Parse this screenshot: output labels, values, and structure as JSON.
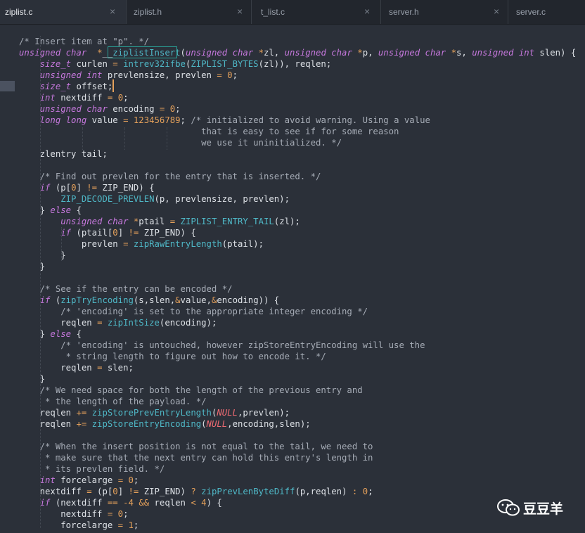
{
  "tabs": [
    {
      "label": "ziplist.c",
      "active": true
    },
    {
      "label": "ziplist.h",
      "active": false
    },
    {
      "label": "t_list.c",
      "active": false
    },
    {
      "label": "server.h",
      "active": false
    },
    {
      "label": "server.c",
      "active": false
    }
  ],
  "close_glyph": "×",
  "watermark": {
    "text": "豆豆羊",
    "icon": "wechat-icon"
  },
  "code": [
    [
      [
        "cm",
        "/* Insert item at \"p\". */"
      ]
    ],
    [
      [
        "ty",
        "unsigned char"
      ],
      [
        "",
        "  "
      ],
      [
        "op",
        "*"
      ],
      [
        "",
        "__"
      ],
      [
        "fn",
        "ziplistInsert"
      ],
      [
        "",
        "("
      ],
      [
        "ty",
        "unsigned char"
      ],
      [
        "",
        " "
      ],
      [
        "op",
        "*"
      ],
      [
        "",
        "zl, "
      ],
      [
        "ty",
        "unsigned char"
      ],
      [
        "",
        " "
      ],
      [
        "op",
        "*"
      ],
      [
        "",
        "p, "
      ],
      [
        "ty",
        "unsigned char"
      ],
      [
        "",
        " "
      ],
      [
        "op",
        "*"
      ],
      [
        "",
        "s, "
      ],
      [
        "ty",
        "unsigned int"
      ],
      [
        "",
        " slen) {"
      ]
    ],
    [
      [
        "",
        "    "
      ],
      [
        "ty",
        "size_t"
      ],
      [
        "",
        " curlen "
      ],
      [
        "op",
        "="
      ],
      [
        "",
        " "
      ],
      [
        "fn",
        "intrev32ifbe"
      ],
      [
        "",
        "("
      ],
      [
        "fn",
        "ZIPLIST_BYTES"
      ],
      [
        "",
        "(zl)), reqlen;"
      ]
    ],
    [
      [
        "",
        "    "
      ],
      [
        "ty",
        "unsigned int"
      ],
      [
        "",
        " prevlensize, prevlen "
      ],
      [
        "op",
        "="
      ],
      [
        "",
        " "
      ],
      [
        "num",
        "0"
      ],
      [
        "",
        ";"
      ]
    ],
    [
      [
        "",
        "    "
      ],
      [
        "ty",
        "size_t"
      ],
      [
        "",
        " offset;"
      ]
    ],
    [
      [
        "",
        "    "
      ],
      [
        "ty",
        "int"
      ],
      [
        "",
        " nextdiff "
      ],
      [
        "op",
        "="
      ],
      [
        "",
        " "
      ],
      [
        "num",
        "0"
      ],
      [
        "",
        ";"
      ]
    ],
    [
      [
        "",
        "    "
      ],
      [
        "ty",
        "unsigned char"
      ],
      [
        "",
        " encoding "
      ],
      [
        "op",
        "="
      ],
      [
        "",
        " "
      ],
      [
        "num",
        "0"
      ],
      [
        "",
        ";"
      ]
    ],
    [
      [
        "",
        "    "
      ],
      [
        "ty",
        "long long"
      ],
      [
        "",
        " value "
      ],
      [
        "op",
        "="
      ],
      [
        "",
        " "
      ],
      [
        "num",
        "123456789"
      ],
      [
        "",
        "; "
      ],
      [
        "cm",
        "/* initialized to avoid warning. Using a value"
      ]
    ],
    [
      [
        "cm",
        "                                   that is easy to see if for some reason"
      ]
    ],
    [
      [
        "cm",
        "                                   we use it uninitialized. */"
      ]
    ],
    [
      [
        "",
        "    zlentry tail;"
      ]
    ],
    [
      [
        "",
        ""
      ]
    ],
    [
      [
        "",
        "    "
      ],
      [
        "cm",
        "/* Find out prevlen for the entry that is inserted. */"
      ]
    ],
    [
      [
        "",
        "    "
      ],
      [
        "ty",
        "if"
      ],
      [
        "",
        " (p["
      ],
      [
        "num",
        "0"
      ],
      [
        "",
        "] "
      ],
      [
        "op",
        "!="
      ],
      [
        "",
        " ZIP_END) {"
      ]
    ],
    [
      [
        "",
        "        "
      ],
      [
        "fn",
        "ZIP_DECODE_PREVLEN"
      ],
      [
        "",
        "(p, prevlensize, prevlen);"
      ]
    ],
    [
      [
        "",
        "    } "
      ],
      [
        "ty",
        "else"
      ],
      [
        "",
        " {"
      ]
    ],
    [
      [
        "",
        "        "
      ],
      [
        "ty",
        "unsigned char"
      ],
      [
        "",
        " "
      ],
      [
        "op",
        "*"
      ],
      [
        "",
        "ptail "
      ],
      [
        "op",
        "="
      ],
      [
        "",
        " "
      ],
      [
        "fn",
        "ZIPLIST_ENTRY_TAIL"
      ],
      [
        "",
        "(zl);"
      ]
    ],
    [
      [
        "",
        "        "
      ],
      [
        "ty",
        "if"
      ],
      [
        "",
        " (ptail["
      ],
      [
        "num",
        "0"
      ],
      [
        "",
        "] "
      ],
      [
        "op",
        "!="
      ],
      [
        "",
        " ZIP_END) {"
      ]
    ],
    [
      [
        "",
        "            prevlen "
      ],
      [
        "op",
        "="
      ],
      [
        "",
        " "
      ],
      [
        "fn",
        "zipRawEntryLength"
      ],
      [
        "",
        "(ptail);"
      ]
    ],
    [
      [
        "",
        "        }"
      ]
    ],
    [
      [
        "",
        "    }"
      ]
    ],
    [
      [
        "",
        ""
      ]
    ],
    [
      [
        "",
        "    "
      ],
      [
        "cm",
        "/* See if the entry can be encoded */"
      ]
    ],
    [
      [
        "",
        "    "
      ],
      [
        "ty",
        "if"
      ],
      [
        "",
        " ("
      ],
      [
        "fn",
        "zipTryEncoding"
      ],
      [
        "",
        "(s,slen,"
      ],
      [
        "op",
        "&"
      ],
      [
        "",
        "value,"
      ],
      [
        "op",
        "&"
      ],
      [
        "",
        "encoding)) {"
      ]
    ],
    [
      [
        "",
        "        "
      ],
      [
        "cm",
        "/* 'encoding' is set to the appropriate integer encoding */"
      ]
    ],
    [
      [
        "",
        "        reqlen "
      ],
      [
        "op",
        "="
      ],
      [
        "",
        " "
      ],
      [
        "fn",
        "zipIntSize"
      ],
      [
        "",
        "(encoding);"
      ]
    ],
    [
      [
        "",
        "    } "
      ],
      [
        "ty",
        "else"
      ],
      [
        "",
        " {"
      ]
    ],
    [
      [
        "",
        "        "
      ],
      [
        "cm",
        "/* 'encoding' is untouched, however zipStoreEntryEncoding will use the"
      ]
    ],
    [
      [
        "cm",
        "         * string length to figure out how to encode it. */"
      ]
    ],
    [
      [
        "",
        "        reqlen "
      ],
      [
        "op",
        "="
      ],
      [
        "",
        " slen;"
      ]
    ],
    [
      [
        "",
        "    }"
      ]
    ],
    [
      [
        "",
        "    "
      ],
      [
        "cm",
        "/* We need space for both the length of the previous entry and"
      ]
    ],
    [
      [
        "cm",
        "     * the length of the payload. */"
      ]
    ],
    [
      [
        "",
        "    reqlen "
      ],
      [
        "op",
        "+="
      ],
      [
        "",
        " "
      ],
      [
        "fn",
        "zipStorePrevEntryLength"
      ],
      [
        "",
        "("
      ],
      [
        "nul",
        "NULL"
      ],
      [
        "",
        ",prevlen);"
      ]
    ],
    [
      [
        "",
        "    reqlen "
      ],
      [
        "op",
        "+="
      ],
      [
        "",
        " "
      ],
      [
        "fn",
        "zipStoreEntryEncoding"
      ],
      [
        "",
        "("
      ],
      [
        "nul",
        "NULL"
      ],
      [
        "",
        ",encoding,slen);"
      ]
    ],
    [
      [
        "",
        ""
      ]
    ],
    [
      [
        "",
        "    "
      ],
      [
        "cm",
        "/* When the insert position is not equal to the tail, we need to"
      ]
    ],
    [
      [
        "cm",
        "     * make sure that the next entry can hold this entry's length in"
      ]
    ],
    [
      [
        "cm",
        "     * its prevlen field. */"
      ]
    ],
    [
      [
        "",
        "    "
      ],
      [
        "ty",
        "int"
      ],
      [
        "",
        " forcelarge "
      ],
      [
        "op",
        "="
      ],
      [
        "",
        " "
      ],
      [
        "num",
        "0"
      ],
      [
        "",
        ";"
      ]
    ],
    [
      [
        "",
        "    nextdiff "
      ],
      [
        "op",
        "="
      ],
      [
        "",
        " (p["
      ],
      [
        "num",
        "0"
      ],
      [
        "",
        "] "
      ],
      [
        "op",
        "!="
      ],
      [
        "",
        " ZIP_END) "
      ],
      [
        "op",
        "?"
      ],
      [
        "",
        " "
      ],
      [
        "fn",
        "zipPrevLenByteDiff"
      ],
      [
        "",
        "(p,reqlen) "
      ],
      [
        "op",
        ":"
      ],
      [
        "",
        " "
      ],
      [
        "num",
        "0"
      ],
      [
        "",
        ";"
      ]
    ],
    [
      [
        "",
        "    "
      ],
      [
        "ty",
        "if"
      ],
      [
        "",
        " (nextdiff "
      ],
      [
        "op",
        "=="
      ],
      [
        "",
        " "
      ],
      [
        "op",
        "-"
      ],
      [
        "num",
        "4"
      ],
      [
        "",
        " "
      ],
      [
        "op",
        "&&"
      ],
      [
        "",
        " reqlen "
      ],
      [
        "op",
        "<"
      ],
      [
        "",
        " "
      ],
      [
        "num",
        "4"
      ],
      [
        "",
        ") {"
      ]
    ],
    [
      [
        "",
        "        nextdiff "
      ],
      [
        "op",
        "="
      ],
      [
        "",
        " "
      ],
      [
        "num",
        "0"
      ],
      [
        "",
        ";"
      ]
    ],
    [
      [
        "",
        "        forcelarge "
      ],
      [
        "op",
        "="
      ],
      [
        "",
        " "
      ],
      [
        "num",
        "1"
      ],
      [
        "",
        ";"
      ]
    ]
  ]
}
